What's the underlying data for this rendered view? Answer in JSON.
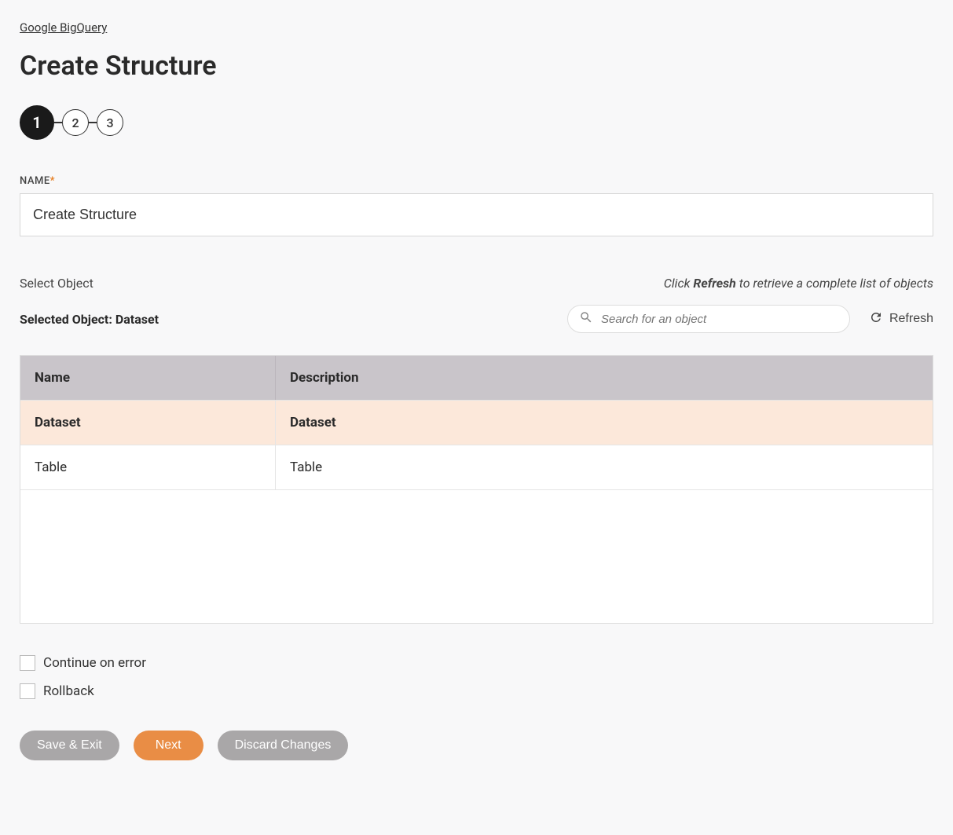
{
  "breadcrumb": "Google BigQuery",
  "page_title": "Create Structure",
  "stepper": {
    "steps": [
      "1",
      "2",
      "3"
    ],
    "active_index": 0
  },
  "name_field": {
    "label": "NAME",
    "required_mark": "*",
    "value": "Create Structure"
  },
  "select_object": {
    "label": "Select Object",
    "hint_prefix": "Click ",
    "hint_bold": "Refresh",
    "hint_suffix": " to retrieve a complete list of objects",
    "selected_prefix": "Selected Object: ",
    "selected_value": "Dataset",
    "search_placeholder": "Search for an object",
    "refresh_label": "Refresh"
  },
  "table": {
    "headers": {
      "name": "Name",
      "description": "Description"
    },
    "rows": [
      {
        "name": "Dataset",
        "description": "Dataset",
        "selected": true
      },
      {
        "name": "Table",
        "description": "Table",
        "selected": false
      }
    ]
  },
  "checkboxes": {
    "continue_on_error": "Continue on error",
    "rollback": "Rollback"
  },
  "buttons": {
    "save_exit": "Save & Exit",
    "next": "Next",
    "discard": "Discard Changes"
  }
}
